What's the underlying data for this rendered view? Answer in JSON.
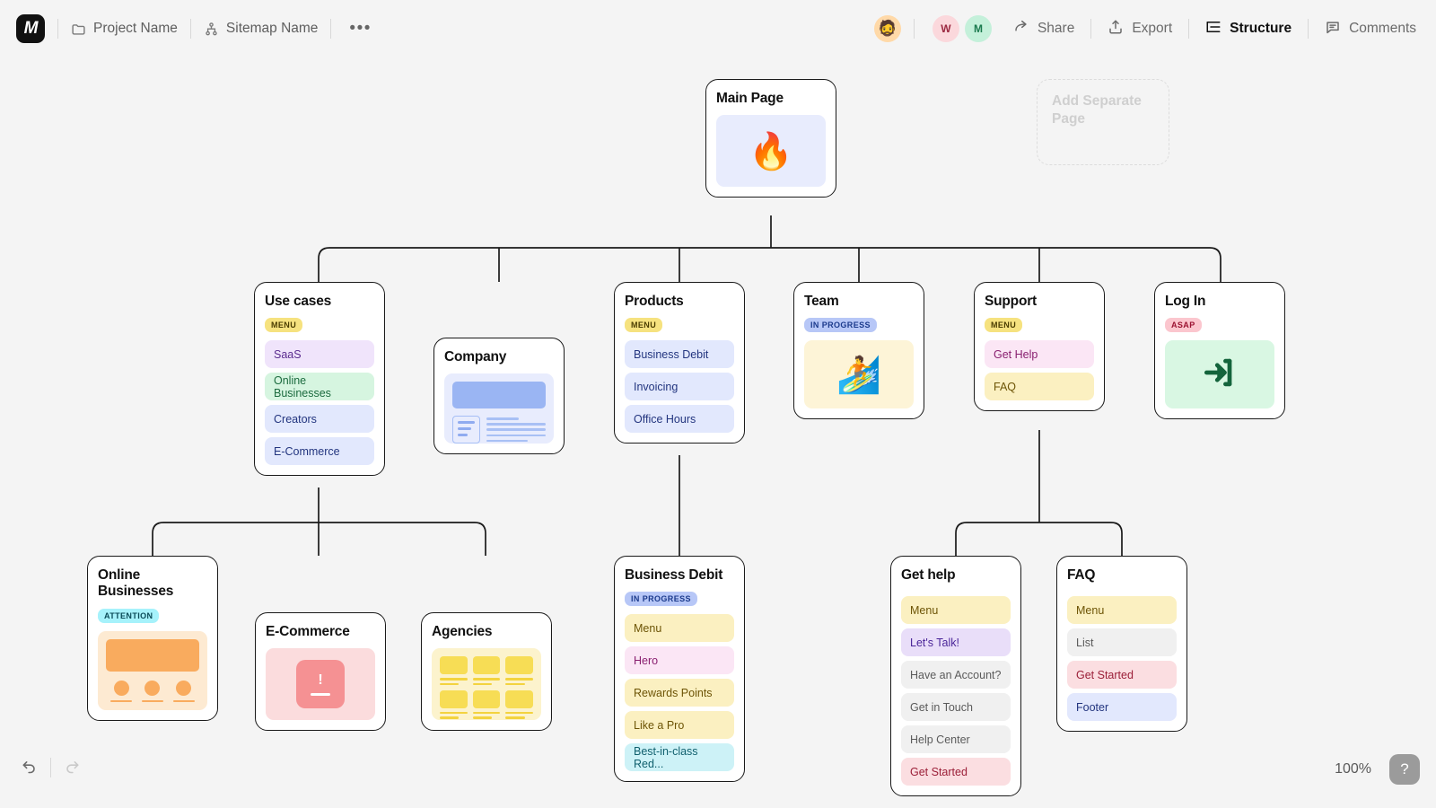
{
  "header": {
    "logo_text": "M",
    "project_icon": "folder-icon",
    "project_name": "Project Name",
    "sitemap_icon": "sitemap-icon",
    "sitemap_name": "Sitemap Name",
    "more_label": "•••",
    "avatars": [
      {
        "name": "user-avatar-photo",
        "label": "🧔",
        "color": "#ffd9a8"
      },
      {
        "name": "user-avatar-w",
        "label": "W",
        "color": "#fbd8dc"
      },
      {
        "name": "user-avatar-m",
        "label": "M",
        "color": "#c4f0da"
      }
    ],
    "actions": [
      {
        "name": "share-button",
        "icon": "share-arrow-icon",
        "label": "Share",
        "active": false
      },
      {
        "name": "export-button",
        "icon": "export-upload-icon",
        "label": "Export",
        "active": false
      },
      {
        "name": "structure-button",
        "icon": "structure-icon",
        "label": "Structure",
        "active": true
      },
      {
        "name": "comments-button",
        "icon": "comment-bubble-icon",
        "label": "Comments",
        "active": false
      }
    ]
  },
  "canvas": {
    "root": {
      "title": "Main Page",
      "thumb_emoji": "🔥"
    },
    "placeholder": {
      "label": "Add Separate Page"
    },
    "level2": [
      {
        "title": "Use cases",
        "badge": {
          "label": "MENU",
          "style": "menu"
        },
        "rows": [
          {
            "label": "SaaS",
            "style": "violet"
          },
          {
            "label": "Online Businesses",
            "style": "green"
          },
          {
            "label": "Creators",
            "style": "blue"
          },
          {
            "label": "E-Commerce",
            "style": "blue"
          }
        ]
      },
      {
        "title": "Company",
        "badge": null,
        "thumb": "company-layout-preview",
        "rows": []
      },
      {
        "title": "Products",
        "badge": {
          "label": "MENU",
          "style": "menu"
        },
        "rows": [
          {
            "label": "Business Debit",
            "style": "blue"
          },
          {
            "label": "Invoicing",
            "style": "blue"
          },
          {
            "label": "Office Hours",
            "style": "blue"
          }
        ]
      },
      {
        "title": "Team",
        "badge": {
          "label": "IN PROGRESS",
          "style": "progress"
        },
        "thumb_emoji": "🏄",
        "rows": []
      },
      {
        "title": "Support",
        "badge": {
          "label": "MENU",
          "style": "menu"
        },
        "rows": [
          {
            "label": "Get Help",
            "style": "pink"
          },
          {
            "label": "FAQ",
            "style": "yellow"
          }
        ]
      },
      {
        "title": "Log In",
        "badge": {
          "label": "ASAP",
          "style": "asap"
        },
        "thumb_icon": "login-arrow-icon",
        "rows": []
      }
    ],
    "level3": [
      {
        "title": "Online Businesses",
        "badge": {
          "label": "ATTENTION",
          "style": "attention"
        },
        "thumb": "profile-cards-preview",
        "rows": []
      },
      {
        "title": "E-Commerce",
        "badge": null,
        "thumb": "alert-card-preview",
        "rows": []
      },
      {
        "title": "Agencies",
        "badge": null,
        "thumb": "grid-cards-preview",
        "rows": []
      },
      {
        "title": "Business Debit",
        "badge": {
          "label": "IN PROGRESS",
          "style": "progress"
        },
        "rows": [
          {
            "label": "Menu",
            "style": "yellow"
          },
          {
            "label": "Hero",
            "style": "pink"
          },
          {
            "label": "Rewards Points",
            "style": "yellow"
          },
          {
            "label": "Like a Pro",
            "style": "yellow"
          },
          {
            "label": "Best-in-class Red...",
            "style": "cyan"
          }
        ]
      },
      {
        "title": "Get help",
        "badge": null,
        "rows": [
          {
            "label": "Menu",
            "style": "yellow"
          },
          {
            "label": "Let's Talk!",
            "style": "lilac"
          },
          {
            "label": "Have an Account?",
            "style": "gray"
          },
          {
            "label": "Get in Touch",
            "style": "gray"
          },
          {
            "label": "Help Center",
            "style": "gray"
          },
          {
            "label": "Get Started",
            "style": "red"
          }
        ]
      },
      {
        "title": "FAQ",
        "badge": null,
        "rows": [
          {
            "label": "Menu",
            "style": "yellow"
          },
          {
            "label": "List",
            "style": "gray"
          },
          {
            "label": "Get Started",
            "style": "red"
          },
          {
            "label": "Footer",
            "style": "blue"
          }
        ]
      }
    ]
  },
  "footer": {
    "undo_label": "undo-icon",
    "redo_label": "redo-icon",
    "zoom_level": "100%",
    "help_label": "?"
  }
}
